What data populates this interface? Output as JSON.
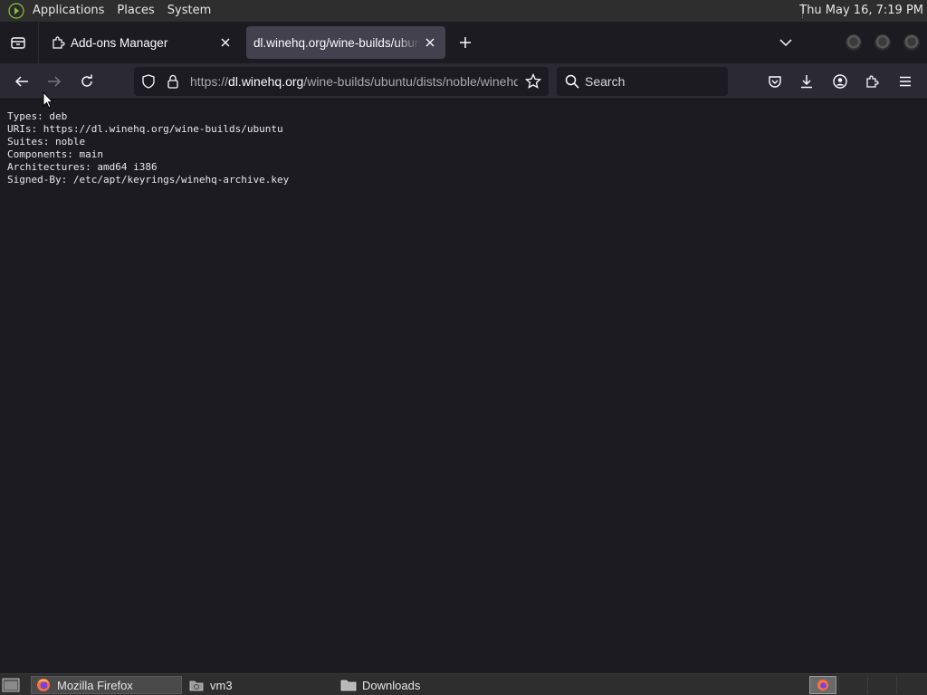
{
  "top_panel": {
    "menus": [
      "Applications",
      "Places",
      "System"
    ],
    "clock": "Thu May 16,  7:19 PM"
  },
  "tabs": [
    {
      "label": "Add-ons Manager",
      "icon": "puzzle-icon",
      "active": false
    },
    {
      "label": "dl.winehq.org/wine-builds/ubuntu",
      "icon": "",
      "active": true
    }
  ],
  "navbar": {
    "url_prefix": "https://",
    "url_host": "dl.winehq.org",
    "url_path": "/wine-builds/ubuntu/dists/noble/winehq-noble.sources",
    "search_placeholder": "Search"
  },
  "page": {
    "lines": [
      "Types: deb",
      "URIs: https://dl.winehq.org/wine-builds/ubuntu",
      "Suites: noble",
      "Components: main",
      "Architectures: amd64 i386",
      "Signed-By: /etc/apt/keyrings/winehq-archive.key"
    ]
  },
  "taskbar": {
    "tasks": [
      {
        "label": "Mozilla Firefox",
        "icon": "firefox-icon",
        "active": true
      },
      {
        "label": "vm3",
        "icon": "file-manager-icon",
        "active": false
      },
      {
        "label": "Downloads",
        "icon": "folder-icon",
        "active": false
      }
    ]
  },
  "colors": {
    "toolbar": "#2b2a33",
    "content": "#1c1b22",
    "active_tab": "#42414d",
    "panel": "#2e2e2e"
  }
}
